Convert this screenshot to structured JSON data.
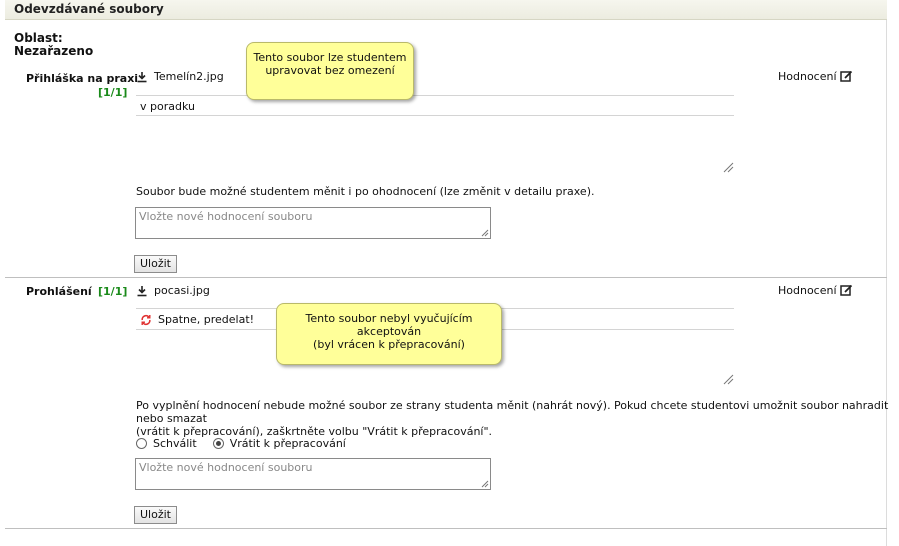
{
  "panel": {
    "title": "Odevzdávané soubory"
  },
  "area": {
    "label": "Oblast:",
    "value": "Nezařazeno"
  },
  "sections": [
    {
      "name": "Přihláška na praxi",
      "count": "[1/1]",
      "file_name": "Temelín2.jpg",
      "rating_link": "Hodnocení",
      "comment": "v poradku",
      "tooltip_line1": "Tento soubor lze studentem",
      "tooltip_line2": "upravovat bez omezení",
      "note": "Soubor bude možné studentem měnit i po ohodnocení (lze změnit v detailu praxe).",
      "textarea_placeholder": "Vložte nové hodnocení souboru",
      "save_label": "Uložit"
    },
    {
      "name": "Prohlášení",
      "count": "[1/1]",
      "file_name": "pocasi.jpg",
      "rating_link": "Hodnocení",
      "comment": "Spatne, predelat!",
      "tooltip_line1": "Tento soubor nebyl vyučujícím akceptován",
      "tooltip_line2": "(byl vrácen k přepracování)",
      "note_line1": "Po vyplnění hodnocení nebude možné soubor ze strany studenta měnit (nahrát nový). Pokud chcete studentovi umožnit soubor nahradit nebo smazat",
      "note_line2": "(vrátit k přepracování), zaškrtněte volbu \"Vrátit k přepracování\".",
      "option_approve": "Schválit",
      "option_return": "Vrátit k přepracování",
      "selected_option": "Vrátit k přepracování",
      "textarea_placeholder": "Vložte nové hodnocení souboru",
      "save_label": "Uložit"
    }
  ],
  "colors": {
    "count_green": "#1a8a1a",
    "tooltip_yellow": "#ffff99",
    "return_icon_red": "#e03030"
  },
  "icons": [
    "download-icon",
    "edit-icon",
    "refresh-icon",
    "resize-grip-icon"
  ]
}
